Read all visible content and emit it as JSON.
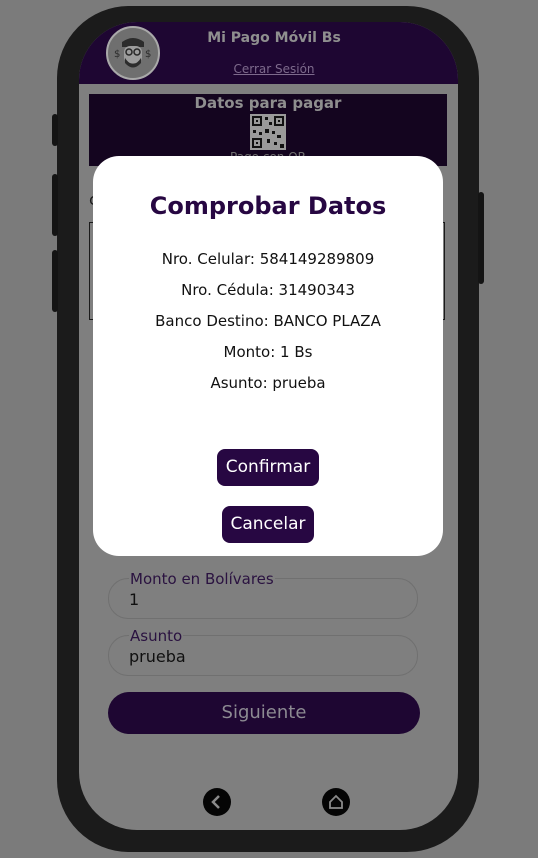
{
  "header": {
    "app_title": "Mi Pago Móvil Bs",
    "logout_label": "Cerrar Sesión"
  },
  "pay_section": {
    "title": "Datos para pagar",
    "qr_label": "Pago con QR"
  },
  "form": {
    "amount": {
      "label": "Monto en Bolívares",
      "value": "1"
    },
    "subject": {
      "label": "Asunto",
      "value": "prueba"
    },
    "next_label": "Siguiente"
  },
  "modal": {
    "title": "Comprobar Datos",
    "lines": [
      "Nro. Celular: 584149289809",
      "Nro. Cédula: 31490343",
      "Banco Destino: BANCO PLAZA",
      "Monto: 1 Bs",
      "Asunto: prueba"
    ],
    "confirm_label": "Confirmar",
    "cancel_label": "Cancelar"
  },
  "colors": {
    "brand": "#270742",
    "overlay": "#7f7f7f"
  },
  "icons": {
    "back": "chevron-left-icon",
    "home": "home-icon"
  }
}
